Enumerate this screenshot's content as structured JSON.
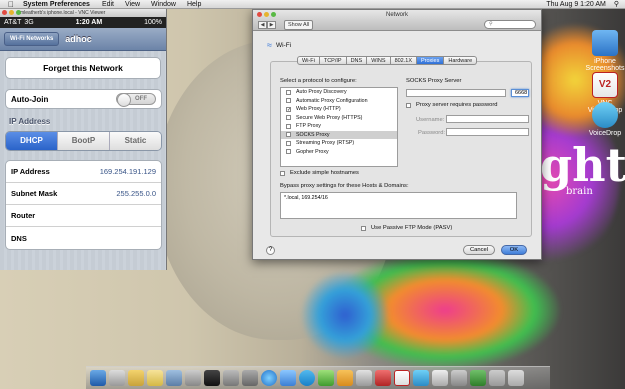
{
  "menubar": {
    "app_name": "System Preferences",
    "menus": [
      "Edit",
      "View",
      "Window",
      "Help"
    ],
    "clock": "Thu Aug 9  1:20 AM"
  },
  "desktop": {
    "wallpaper_word": "ght",
    "wallpaper_sub": "brain",
    "icons": [
      {
        "label": "iPhone Screenshots"
      },
      {
        "label": "VNC Viewer.app"
      },
      {
        "label": "VoiceDrop"
      }
    ]
  },
  "vnc_window": {
    "title": "mleatherb's iphone.local - VNC Viewer",
    "status": {
      "carrier": "AT&T",
      "network": "3G",
      "time": "1:20 AM",
      "battery": "100%"
    },
    "nav": {
      "back_label": "Wi-Fi Networks",
      "title": "adhoc"
    },
    "forget_label": "Forget this Network",
    "autojoin_label": "Auto-Join",
    "autojoin_state": "OFF",
    "ip_section": "IP Address",
    "segments": [
      "DHCP",
      "BootP",
      "Static"
    ],
    "selected_segment": "DHCP",
    "rows": [
      {
        "key": "IP Address",
        "value": "169.254.191.129"
      },
      {
        "key": "Subnet Mask",
        "value": "255.255.0.0"
      },
      {
        "key": "Router",
        "value": ""
      },
      {
        "key": "DNS",
        "value": ""
      }
    ]
  },
  "network_window": {
    "title": "Network",
    "show_all": "Show All",
    "interface": "Wi-Fi",
    "tabs": [
      "Wi-Fi",
      "TCP/IP",
      "DNS",
      "WINS",
      "802.1X",
      "Proxies",
      "Hardware"
    ],
    "active_tab": "Proxies",
    "protocol_heading": "Select a protocol to configure:",
    "protocols": [
      {
        "label": "Auto Proxy Discovery",
        "checked": false,
        "selected": false
      },
      {
        "label": "Automatic Proxy Configuration",
        "checked": false,
        "selected": false
      },
      {
        "label": "Web Proxy (HTTP)",
        "checked": true,
        "selected": false
      },
      {
        "label": "Secure Web Proxy (HTTPS)",
        "checked": false,
        "selected": false
      },
      {
        "label": "FTP Proxy",
        "checked": false,
        "selected": false
      },
      {
        "label": "SOCKS Proxy",
        "checked": false,
        "selected": true
      },
      {
        "label": "Streaming Proxy (RTSP)",
        "checked": false,
        "selected": false
      },
      {
        "label": "Gopher Proxy",
        "checked": false,
        "selected": false
      }
    ],
    "socks_heading": "SOCKS Proxy Server",
    "socks_server": "",
    "socks_port": "6668",
    "requires_password_label": "Proxy server requires password",
    "username_label": "Username:",
    "password_label": "Password:",
    "exclude_simple_label": "Exclude simple hostnames",
    "bypass_label": "Bypass proxy settings for these Hosts & Domains:",
    "bypass_value": "*.local, 169.254/16",
    "pasv_label": "Use Passive FTP Mode (PASV)",
    "help_label": "?",
    "cancel_label": "Cancel",
    "ok_label": "OK"
  }
}
